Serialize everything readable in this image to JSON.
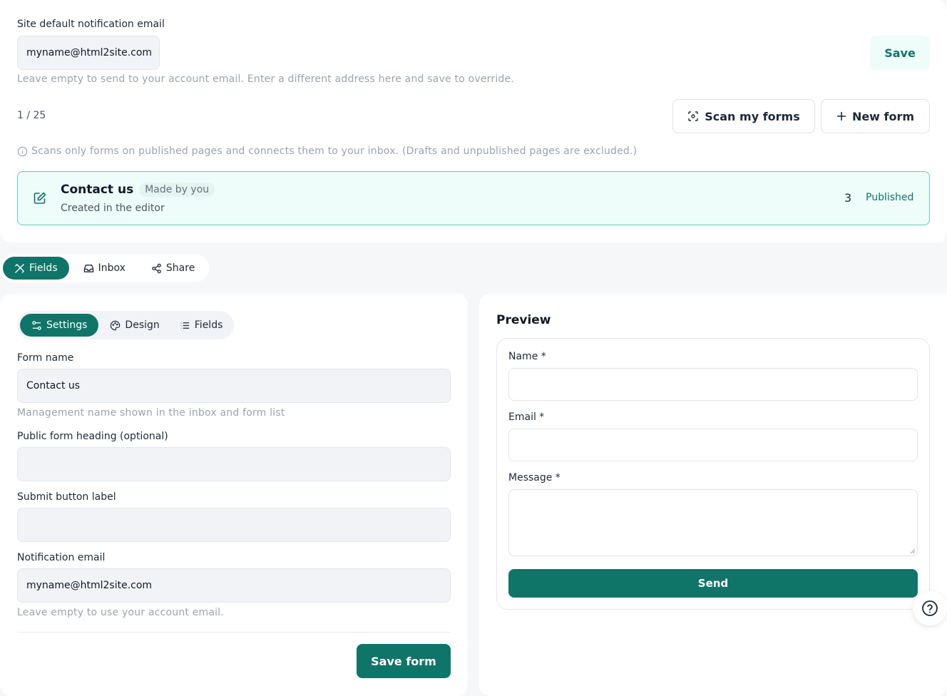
{
  "site_email": {
    "label": "Site default notification email",
    "value": "myname@html2site.com",
    "save_label": "Save",
    "hint": "Leave empty to send to your account email. Enter a different address here and save to override."
  },
  "forms_bar": {
    "count": "1 / 25",
    "scan_label": "Scan my forms",
    "new_label": "New form",
    "scan_info": "Scans only forms on published pages and connects them to your inbox. (Drafts and unpublished pages are excluded.)"
  },
  "form_card": {
    "title": "Contact us",
    "badge": "Made by you",
    "subtitle": "Created in the editor",
    "count": "3",
    "status": "Published"
  },
  "main_tabs": [
    {
      "label": "Fields",
      "icon": "tools-icon",
      "active": true
    },
    {
      "label": "Inbox",
      "icon": "inbox-icon",
      "active": false
    },
    {
      "label": "Share",
      "icon": "share-icon",
      "active": false
    }
  ],
  "editor": {
    "subtabs": [
      {
        "label": "Settings",
        "icon": "sliders-icon",
        "active": true
      },
      {
        "label": "Design",
        "icon": "palette-icon",
        "active": false
      },
      {
        "label": "Fields",
        "icon": "list-icon",
        "active": false
      }
    ],
    "form_name_label": "Form name",
    "form_name_value": "Contact us",
    "form_name_hint": "Management name shown in the inbox and form list",
    "heading_label": "Public form heading (optional)",
    "heading_value": "",
    "submit_label": "Submit button label",
    "submit_value": "",
    "notify_label": "Notification email",
    "notify_value": "myname@html2site.com",
    "notify_hint": "Leave empty to use your account email.",
    "save_form_label": "Save form"
  },
  "preview": {
    "title": "Preview",
    "name_label": "Name *",
    "email_label": "Email *",
    "message_label": "Message *",
    "send_label": "Send"
  },
  "colors": {
    "accent": "#107569",
    "accent_light": "#eefcfa",
    "card_border": "#5ecfbf"
  }
}
